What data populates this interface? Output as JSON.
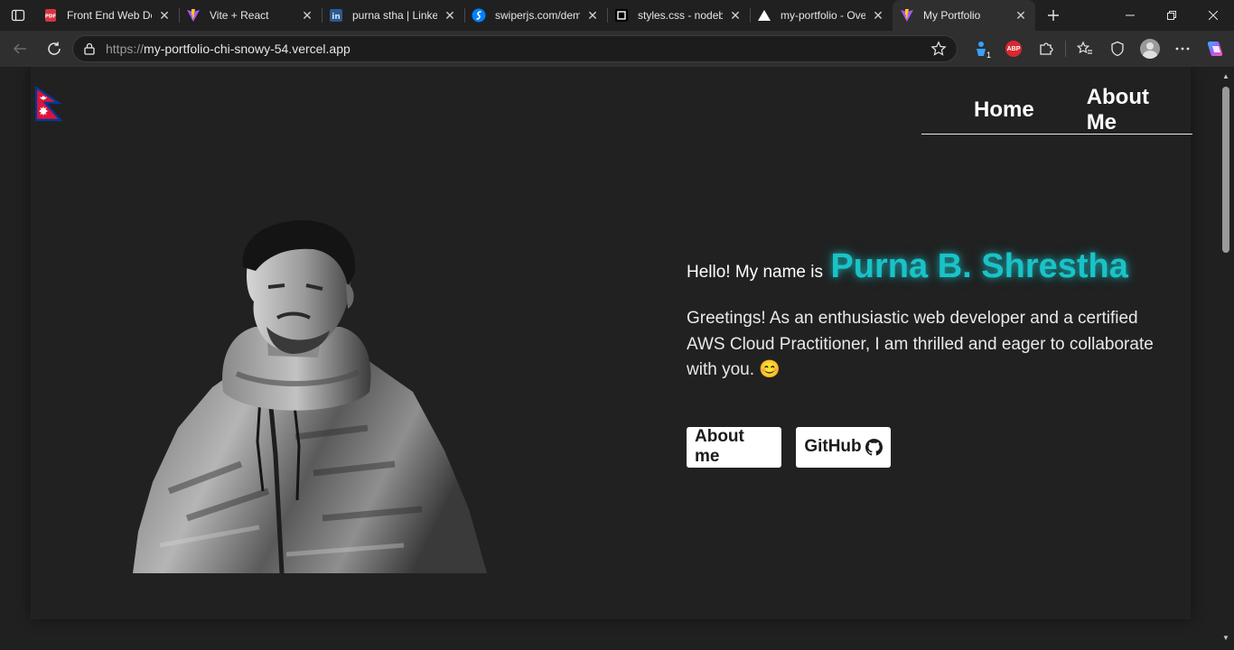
{
  "browser": {
    "tabs": [
      {
        "title": "Front End Web De",
        "icon": "pdf-icon"
      },
      {
        "title": "Vite + React",
        "icon": "vite-icon"
      },
      {
        "title": "purna stha | Linke",
        "icon": "linkedin-icon"
      },
      {
        "title": "swiperjs.com/dem",
        "icon": "swiper-icon"
      },
      {
        "title": "styles.css - nodeb",
        "icon": "codesandbox-icon"
      },
      {
        "title": "my-portfolio - Ove",
        "icon": "vercel-icon"
      },
      {
        "title": "My Portfolio",
        "icon": "vite-icon",
        "active": true
      }
    ],
    "url_scheme": "https://",
    "url_host": "my-portfolio-chi-snowy-54.vercel.app",
    "extension_badge": "1",
    "abp_label": "ABP"
  },
  "nav": {
    "links": [
      "Home",
      "About Me"
    ]
  },
  "hero": {
    "greeting": "Hello! My name is",
    "name": "Purna B. Shrestha",
    "bio": "Greetings! As an enthusiastic web developer and a certified AWS Cloud Practitioner, I am thrilled and eager to collaborate with you. 😊",
    "buttons": {
      "about": "About me",
      "github": "GitHub"
    }
  },
  "colors": {
    "accent": "#19c3c8",
    "background": "#212121",
    "flag_red": "#dc143c",
    "flag_blue": "#003893"
  }
}
